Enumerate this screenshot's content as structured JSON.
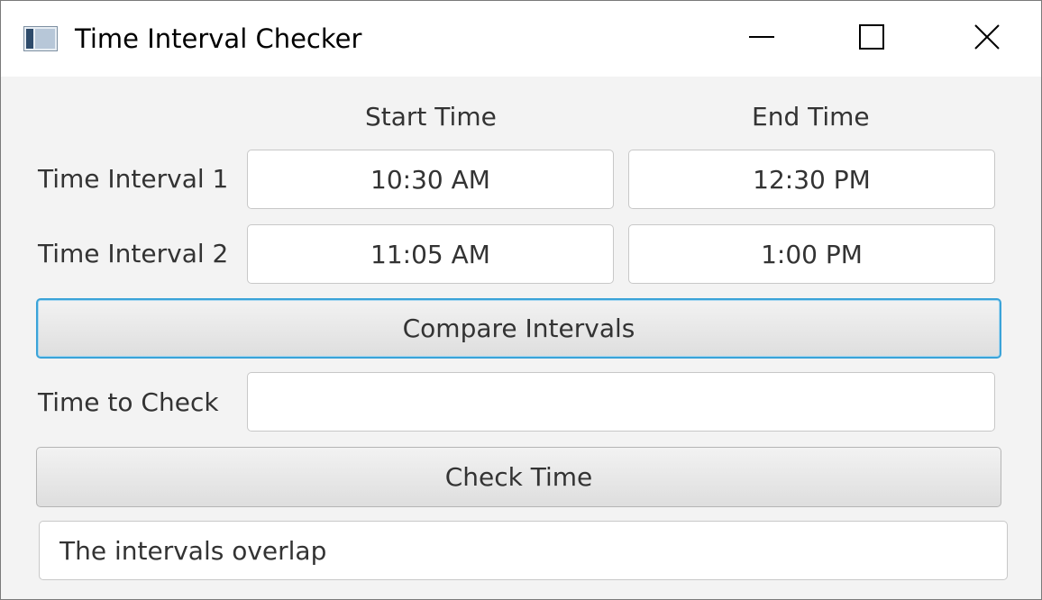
{
  "window": {
    "title": "Time Interval Checker"
  },
  "columns": {
    "start_label": "Start Time",
    "end_label": "End Time"
  },
  "intervals": [
    {
      "label": "Time Interval 1",
      "start": "10:30 AM",
      "end": "12:30 PM"
    },
    {
      "label": "Time Interval 2",
      "start": "11:05 AM",
      "end": "1:00 PM"
    }
  ],
  "compare_button": {
    "label": "Compare Intervals"
  },
  "check": {
    "label": "Time to Check",
    "value": ""
  },
  "check_button": {
    "label": "Check Time"
  },
  "result": {
    "value": "The intervals overlap"
  },
  "colors": {
    "focus_ring": "#3aa3d8",
    "window_bg": "#f3f3f3"
  },
  "icons": {
    "app": "app-window-icon",
    "minimize": "minimize-icon",
    "maximize": "maximize-icon",
    "close": "close-icon"
  }
}
